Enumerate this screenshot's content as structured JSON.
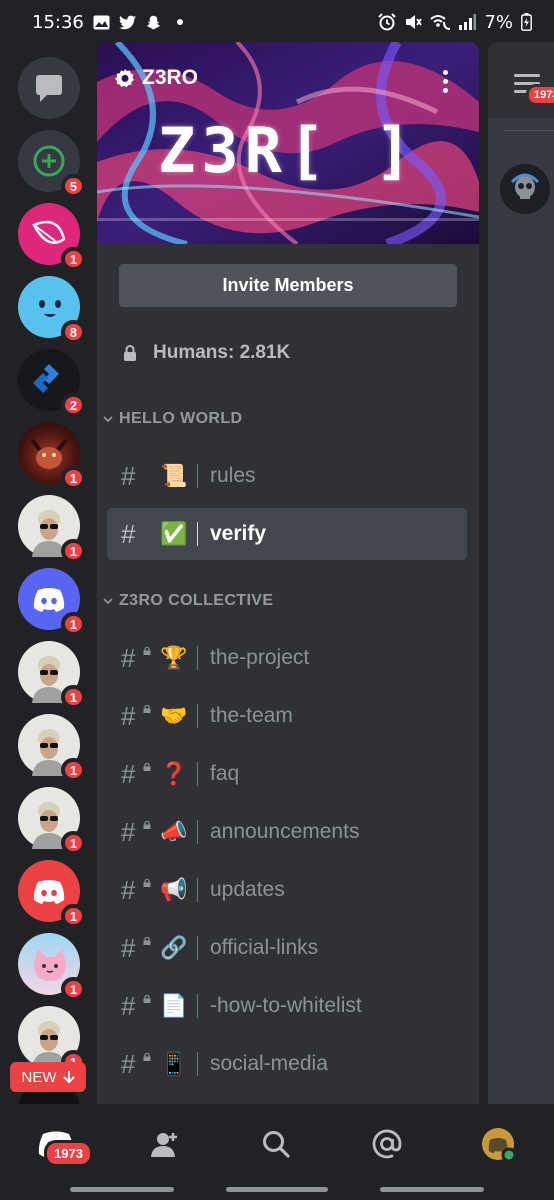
{
  "status_bar": {
    "time": "15:36",
    "battery": "7%"
  },
  "server_rail": {
    "servers": [
      {
        "name": "direct-messages",
        "badge": ""
      },
      {
        "name": "add-server",
        "badge": "5"
      },
      {
        "name": "server-pink-leaf",
        "badge": "1"
      },
      {
        "name": "server-blue-face",
        "badge": "8"
      },
      {
        "name": "server-blue-diamond",
        "badge": "2"
      },
      {
        "name": "server-red-creature",
        "badge": "1"
      },
      {
        "name": "server-avatar-sunglasses-1",
        "badge": "1"
      },
      {
        "name": "server-discord-blurple",
        "badge": "1"
      },
      {
        "name": "server-avatar-sunglasses-2",
        "badge": "1"
      },
      {
        "name": "server-avatar-sunglasses-3",
        "badge": "1"
      },
      {
        "name": "server-avatar-sunglasses-4",
        "badge": "1"
      },
      {
        "name": "server-discord-red",
        "badge": "1"
      },
      {
        "name": "server-pink-cat",
        "badge": "1"
      },
      {
        "name": "server-avatar-sunglasses-5",
        "badge": "1"
      }
    ],
    "new_pill": "NEW"
  },
  "server": {
    "name": "Z3RO",
    "banner_logo": "Z3R[ ]",
    "invite_label": "Invite Members",
    "humans_label": "Humans: 2.81K"
  },
  "categories": [
    {
      "title": "HELLO WORLD",
      "channels": [
        {
          "emoji": "📜",
          "name": "rules",
          "locked": false,
          "active": false
        },
        {
          "emoji": "✅",
          "name": "verify",
          "locked": false,
          "active": true
        }
      ]
    },
    {
      "title": "Z3RO COLLECTIVE",
      "channels": [
        {
          "emoji": "🏆",
          "name": "the-project",
          "locked": true,
          "active": false
        },
        {
          "emoji": "🤝",
          "name": "the-team",
          "locked": true,
          "active": false
        },
        {
          "emoji": "❓",
          "name": "faq",
          "locked": true,
          "active": false
        },
        {
          "emoji": "📣",
          "name": "announcements",
          "locked": true,
          "active": false
        },
        {
          "emoji": "📢",
          "name": "updates",
          "locked": true,
          "active": false
        },
        {
          "emoji": "🔗",
          "name": "official-links",
          "locked": true,
          "active": false
        },
        {
          "emoji": "📄",
          "name": "-how-to-whitelist",
          "locked": true,
          "active": false
        },
        {
          "emoji": "📱",
          "name": "social-media",
          "locked": true,
          "active": false
        }
      ]
    }
  ],
  "peek": {
    "badge": "1973"
  },
  "bottom_nav": {
    "badge": "1973",
    "items": [
      "home-icon",
      "friends-icon",
      "search-icon",
      "mentions-icon",
      "profile-avatar"
    ]
  },
  "colors": {
    "badge_red": "#ed4245",
    "blurple": "#5865f2",
    "panel": "#2f3136",
    "rail": "#202225"
  }
}
